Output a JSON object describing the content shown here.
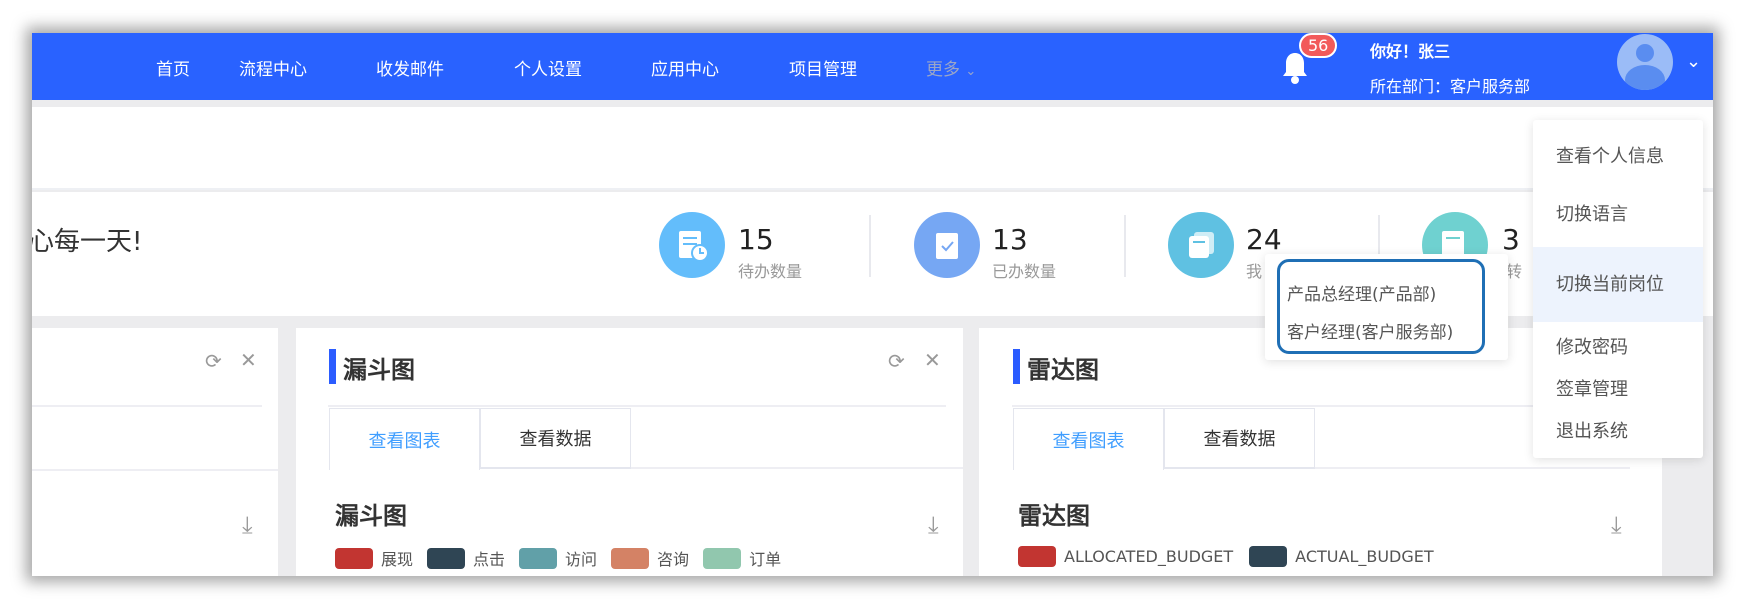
{
  "nav": {
    "items": [
      "首页",
      "流程中心",
      "收发邮件",
      "个人设置",
      "应用中心",
      "项目管理"
    ],
    "more": "更多",
    "notification_count": "56",
    "greeting": "你好！张三",
    "department": "所在部门：客户服务部"
  },
  "welcome": "心每一天!",
  "stats": [
    {
      "value": "15",
      "label": "待办数量",
      "color": "#63bdfb"
    },
    {
      "value": "13",
      "label": "已办数量",
      "color": "#76a7f3"
    },
    {
      "value": "24",
      "label": "我",
      "color": "#5fc1e2"
    },
    {
      "value": "3",
      "label": "转",
      "color": "#6fd1d0"
    }
  ],
  "cards": [
    {
      "title": "漏斗图",
      "tabs": [
        "查看图表",
        "查看数据"
      ],
      "chart_title": "漏斗图",
      "legend": [
        {
          "label": "展现",
          "color": "#c23531"
        },
        {
          "label": "点击",
          "color": "#2f4554"
        },
        {
          "label": "访问",
          "color": "#61a0a8"
        },
        {
          "label": "咨询",
          "color": "#d48265"
        },
        {
          "label": "订单",
          "color": "#91c7ae"
        }
      ]
    },
    {
      "title": "雷达图",
      "tabs": [
        "查看图表",
        "查看数据"
      ],
      "chart_title": "雷达图",
      "legend": [
        {
          "label": "ALLOCATED_BUDGET",
          "color": "#c23531"
        },
        {
          "label": "ACTUAL_BUDGET",
          "color": "#2f4554"
        }
      ]
    }
  ],
  "user_menu": [
    "查看个人信息",
    "切换语言",
    "切换当前岗位",
    "修改密码",
    "签章管理",
    "退出系统"
  ],
  "position_submenu": [
    "产品总经理(产品部)",
    "客户经理(客户服务部)"
  ],
  "colors": {
    "primary": "#2962ff",
    "active_tab": "#409eff"
  }
}
